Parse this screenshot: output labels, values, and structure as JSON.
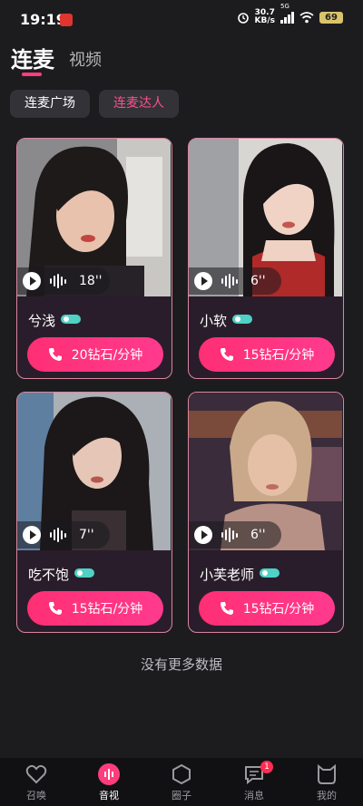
{
  "status_bar": {
    "time": "19:19",
    "net_speed_value": "30.7",
    "net_speed_unit": "KB/s",
    "signal_label": "5G",
    "battery": "69"
  },
  "tabs": {
    "main": "连麦",
    "secondary": "视频"
  },
  "subtabs": {
    "plaza": "连麦广场",
    "talent": "连麦达人"
  },
  "cards": [
    {
      "name": "兮浅",
      "duration": "18''",
      "price": "20钻石/分钟"
    },
    {
      "name": "小软",
      "duration": "6''",
      "price": "15钻石/分钟"
    },
    {
      "name": "吃不饱",
      "duration": "7''",
      "price": "15钻石/分钟"
    },
    {
      "name": "小芙老师",
      "duration": "6''",
      "price": "15钻石/分钟"
    }
  ],
  "footer_text": "没有更多数据",
  "bottom_nav": [
    {
      "label": "召唤",
      "icon": "heart-icon"
    },
    {
      "label": "音视",
      "icon": "audio-wave-icon",
      "active": true
    },
    {
      "label": "圈子",
      "icon": "hexagon-icon"
    },
    {
      "label": "消息",
      "icon": "chat-bubble-icon",
      "badge": "1"
    },
    {
      "label": "我的",
      "icon": "cat-face-icon"
    }
  ],
  "colors": {
    "accent": "#ff3d7d",
    "card_border": "#d9869d",
    "background": "#1c1c1f"
  }
}
